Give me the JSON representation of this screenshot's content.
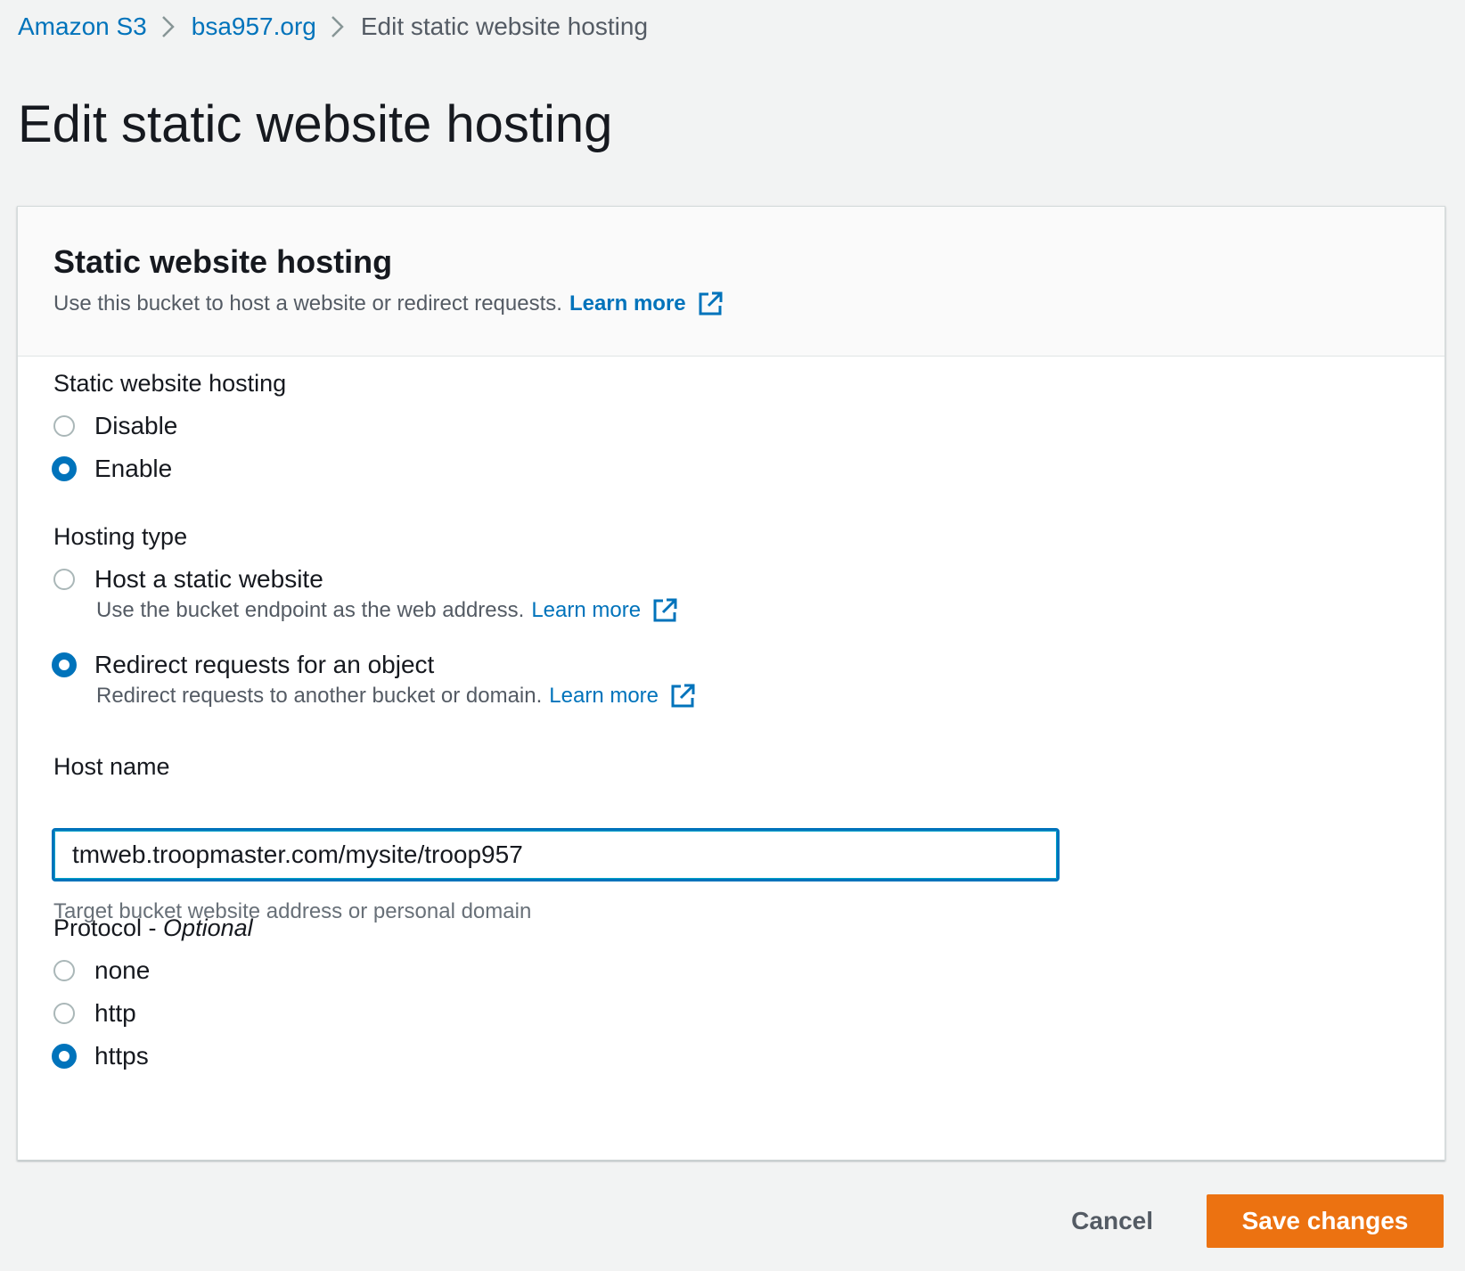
{
  "breadcrumb": {
    "items": [
      "Amazon S3",
      "bsa957.org"
    ],
    "current": "Edit static website hosting"
  },
  "page_title": "Edit static website hosting",
  "panel": {
    "title": "Static website hosting",
    "description": "Use this bucket to host a website or redirect requests.",
    "learn_more": "Learn more"
  },
  "hosting": {
    "label": "Static website hosting",
    "options": [
      "Disable",
      "Enable"
    ],
    "selected": "Enable"
  },
  "hosting_type": {
    "label": "Hosting type",
    "options": [
      {
        "label": "Host a static website",
        "description": "Use the bucket endpoint as the web address.",
        "learn_more": "Learn more"
      },
      {
        "label": "Redirect requests for an object",
        "description": "Redirect requests to another bucket or domain.",
        "learn_more": "Learn more"
      }
    ],
    "selected": "Redirect requests for an object"
  },
  "host_name": {
    "label": "Host name",
    "value": "tmweb.troopmaster.com/mysite/troop957",
    "hint": "Target bucket website address or personal domain"
  },
  "protocol": {
    "label": "Protocol - ",
    "optional": "Optional",
    "options": [
      "none",
      "http",
      "https"
    ],
    "selected": "https"
  },
  "actions": {
    "cancel": "Cancel",
    "save": "Save changes"
  },
  "colors": {
    "link": "#0073bb",
    "primary_button": "#ec7211",
    "radio_checked": "#0073bb",
    "background": "#f2f3f3"
  },
  "icons": [
    "chevron-right-icon",
    "external-link-icon"
  ]
}
